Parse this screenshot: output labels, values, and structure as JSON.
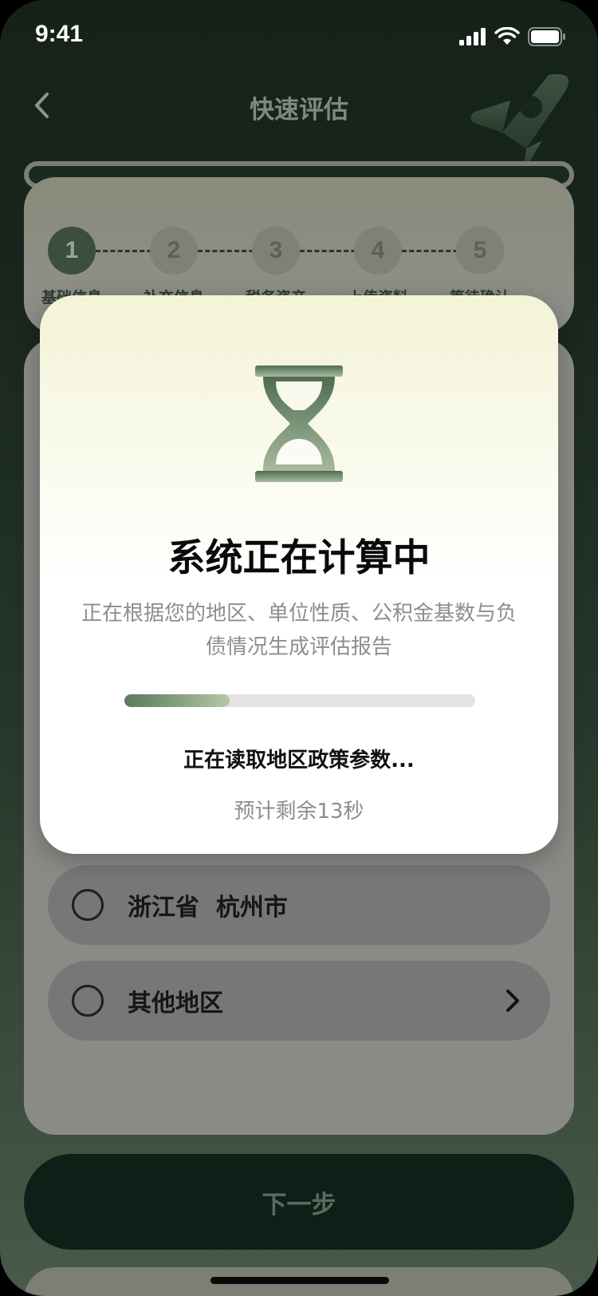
{
  "status_bar": {
    "time": "9:41"
  },
  "nav": {
    "title": "快速评估"
  },
  "steps": [
    {
      "number": "1",
      "label": "基础信息",
      "active": true
    },
    {
      "number": "2",
      "label": "补充信息",
      "active": false
    },
    {
      "number": "3",
      "label": "税务资产",
      "active": false
    },
    {
      "number": "4",
      "label": "上传资料",
      "active": false
    },
    {
      "number": "5",
      "label": "等待确认",
      "active": false
    }
  ],
  "options": [
    {
      "label": "浙江省  杭州市",
      "has_chevron": false
    },
    {
      "label": "其他地区",
      "has_chevron": true
    }
  ],
  "next_button": {
    "label": "下一步"
  },
  "modal": {
    "icon": "hourglass-icon",
    "title": "系统正在计算中",
    "description": "正在根据您的地区、单位性质、公积金基数与负债情况生成评估报告",
    "progress_fraction": 0.3,
    "status_text": "正在读取地区政策参数...",
    "remaining_text": "预计剩余13秒"
  },
  "colors": {
    "accent_green": "#3c4f3d",
    "progress_green": "#5b7a5c",
    "modal_top": "#f3f3d6"
  }
}
